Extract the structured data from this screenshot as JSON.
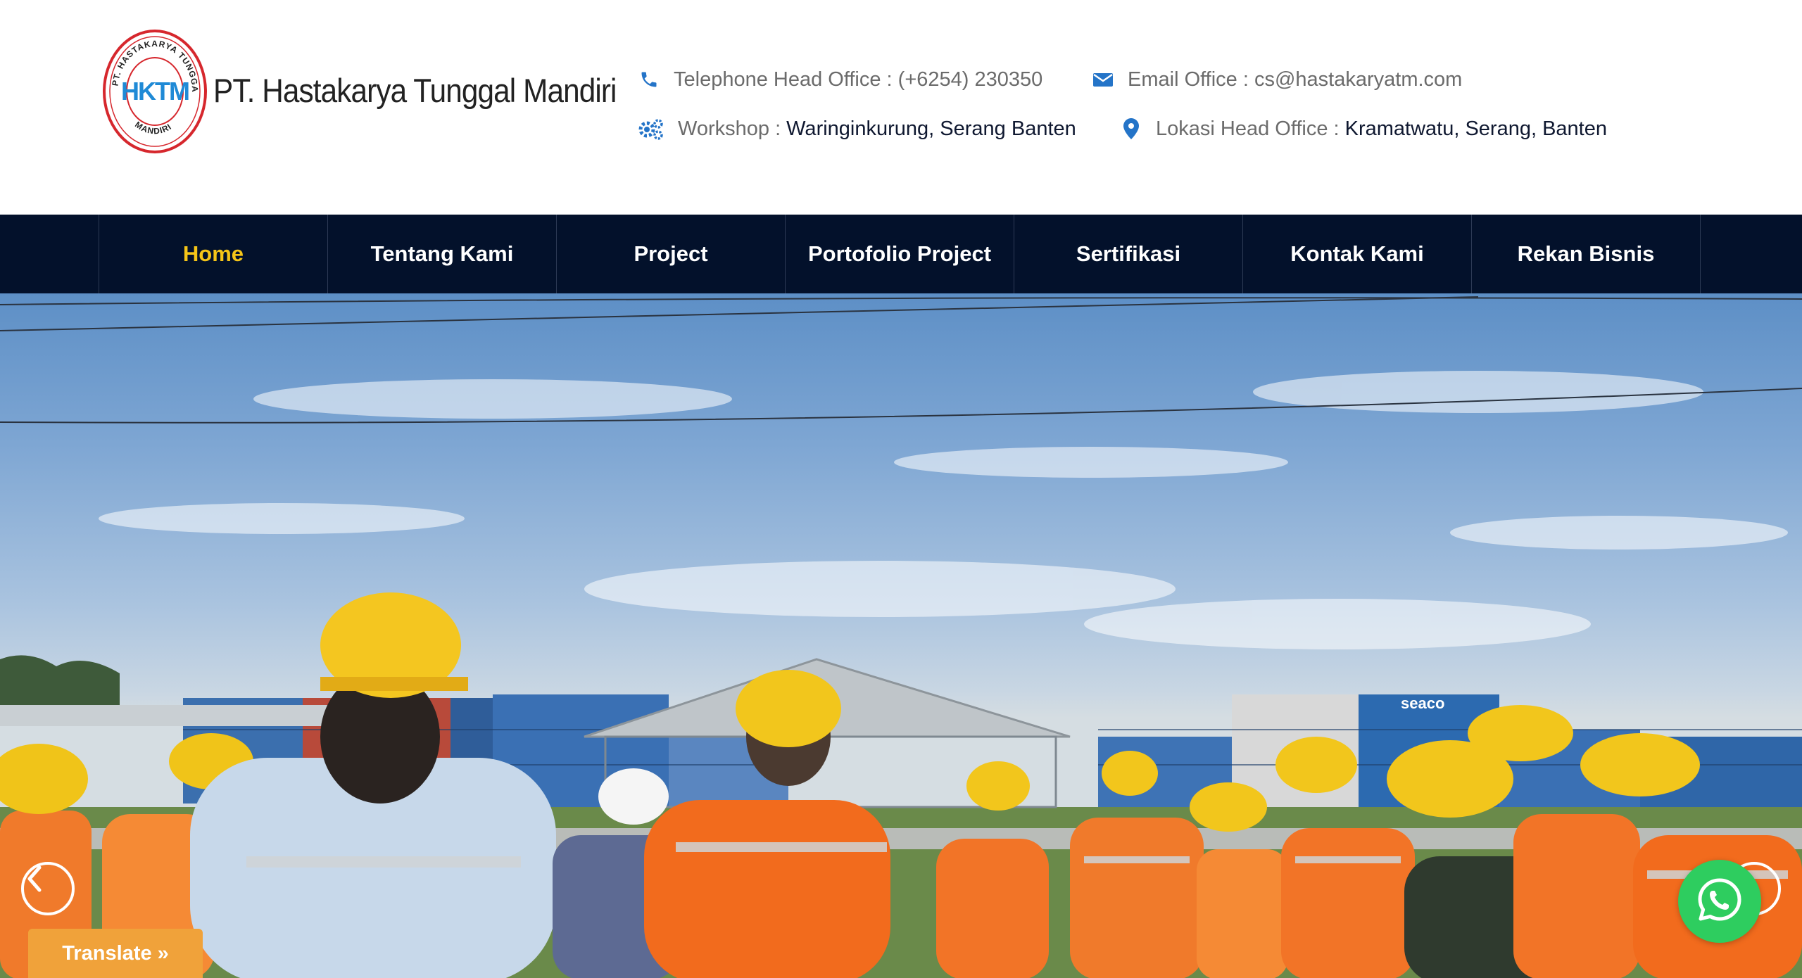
{
  "brand": {
    "name": "PT. Hastakarya Tunggal Mandiri",
    "seal_text_top": "PT. HASTAKARYA TUNGGAL",
    "seal_text_bottom": "MANDIRI",
    "seal_initials": "HKTM"
  },
  "contacts": {
    "phone": {
      "label": "Telephone Head Office : (+6254) 230350",
      "icon": "phone-icon"
    },
    "email": {
      "label": "Email Office : cs@hastakaryatm.com",
      "icon": "envelope-icon"
    },
    "workshop": {
      "label": "Workshop :",
      "value": "Waringinkurung, Serang Banten",
      "icon": "gears-icon"
    },
    "location": {
      "label": "Lokasi Head Office :",
      "value": "Kramatwatu, Serang, Banten",
      "icon": "map-marker-icon"
    }
  },
  "nav": {
    "items": [
      {
        "label": "Home",
        "active": true
      },
      {
        "label": "Tentang Kami"
      },
      {
        "label": "Project"
      },
      {
        "label": "Portofolio Project"
      },
      {
        "label": "Sertifikasi"
      },
      {
        "label": "Kontak Kami"
      },
      {
        "label": "Rekan Bisnis"
      }
    ]
  },
  "hero": {
    "container_brand": "seaco",
    "prev_icon": "chevron-left-icon",
    "next_icon": "chevron-right-icon"
  },
  "widgets": {
    "translate_label": "Translate »",
    "whatsapp_icon": "whatsapp-icon"
  },
  "colors": {
    "nav_bg": "#03112b",
    "nav_active": "#f5c518",
    "icon_blue": "#2474c8",
    "translate_bg": "#f0a23a",
    "whatsapp_bg": "#2ecd5f"
  }
}
